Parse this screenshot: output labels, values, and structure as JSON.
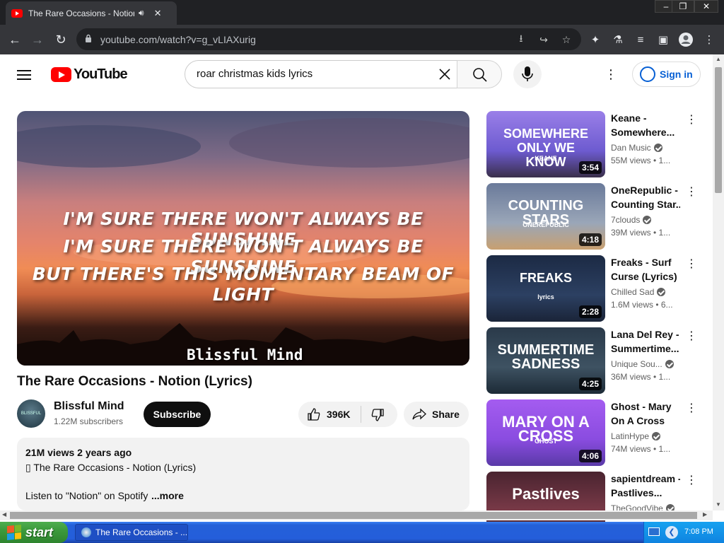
{
  "browser": {
    "tab_title": "The Rare Occasions - Notion (Ly",
    "url": "youtube.com/watch?v=g_vLIAXurig",
    "window_controls": [
      "minimize",
      "restore",
      "close"
    ]
  },
  "header": {
    "logo_text": "YouTube",
    "search_value": "roar christmas kids lyrics",
    "sign_in_label": "Sign in"
  },
  "player": {
    "lyrics": [
      "I'M SURE THERE WON'T ALWAYS BE SUNSHINE",
      "I'M SURE THERE WON'T ALWAYS BE SUNSHINE",
      "BUT THERE'S THIS MOMENTARY BEAM OF LIGHT"
    ],
    "watermark": "Blissful Mind"
  },
  "video": {
    "title": "The Rare Occasions - Notion (Lyrics)",
    "channel_name": "Blissful Mind",
    "avatar_text": "BLISSFUL MIND",
    "subscribers": "1.22M subscribers",
    "subscribe_label": "Subscribe",
    "likes": "396K",
    "share_label": "Share",
    "description": {
      "meta": "21M views  2 years ago",
      "line1": "▯ The Rare Occasions - Notion (Lyrics)",
      "line2": "Listen to \"Notion\" on Spotify",
      "more_label": "...more"
    }
  },
  "recommendations": [
    {
      "thumb_text": "SOMEWHERE ONLY WE KNOW",
      "thumb_sub": "KEANE",
      "duration": "3:54",
      "title1": "Keane -",
      "title2": "Somewhere...",
      "channel": "Dan Music",
      "views": "55M views  • 1...",
      "colors": [
        "#9a7fe8",
        "#6d5bd0",
        "#3a2f4a"
      ]
    },
    {
      "thumb_text": "COUNTING STARS",
      "thumb_sub": "ONEREPUBLIC",
      "duration": "4:18",
      "title1": "OneRepublic -",
      "title2": "Counting Star...",
      "channel": "7clouds",
      "views": "39M views  • 1...",
      "colors": [
        "#6a7a9a",
        "#9aa6b8",
        "#c8a070"
      ]
    },
    {
      "thumb_text": "FREAKS",
      "thumb_sub": "lyrics",
      "duration": "2:28",
      "title1": "Freaks - Surf",
      "title2": "Curse (Lyrics)",
      "channel": "Chilled Sad",
      "views": "1.6M views  • 6...",
      "colors": [
        "#1c2a44",
        "#2c4062",
        "#1a2438"
      ]
    },
    {
      "thumb_text": "SUMMERTIME SADNESS",
      "thumb_sub": "",
      "duration": "4:25",
      "title1": "Lana Del Rey -",
      "title2": "Summertime...",
      "channel": "Unique Sou...",
      "views": "36M views  • 1...",
      "colors": [
        "#2a3a4a",
        "#3e5262",
        "#1c2a36"
      ]
    },
    {
      "thumb_text": "MARY ON A CROSS",
      "thumb_sub": "GHOST",
      "duration": "4:06",
      "title1": "Ghost - Mary",
      "title2": "On A Cross",
      "channel": "LatinHype",
      "views": "74M views  • 1...",
      "colors": [
        "#a45cf0",
        "#8a4ce0",
        "#5a3aa8"
      ]
    },
    {
      "thumb_text": "Pastlives",
      "thumb_sub": "",
      "duration": "",
      "title1": "sapientdream -",
      "title2": "Pastlives...",
      "channel": "TheGoodVibe",
      "views": "",
      "colors": [
        "#4a2430",
        "#7a3a48",
        "#2a1418"
      ]
    }
  ],
  "taskbar": {
    "start_label": "start",
    "task_label": "The Rare Occasions - ...",
    "clock": "7:08 PM"
  }
}
